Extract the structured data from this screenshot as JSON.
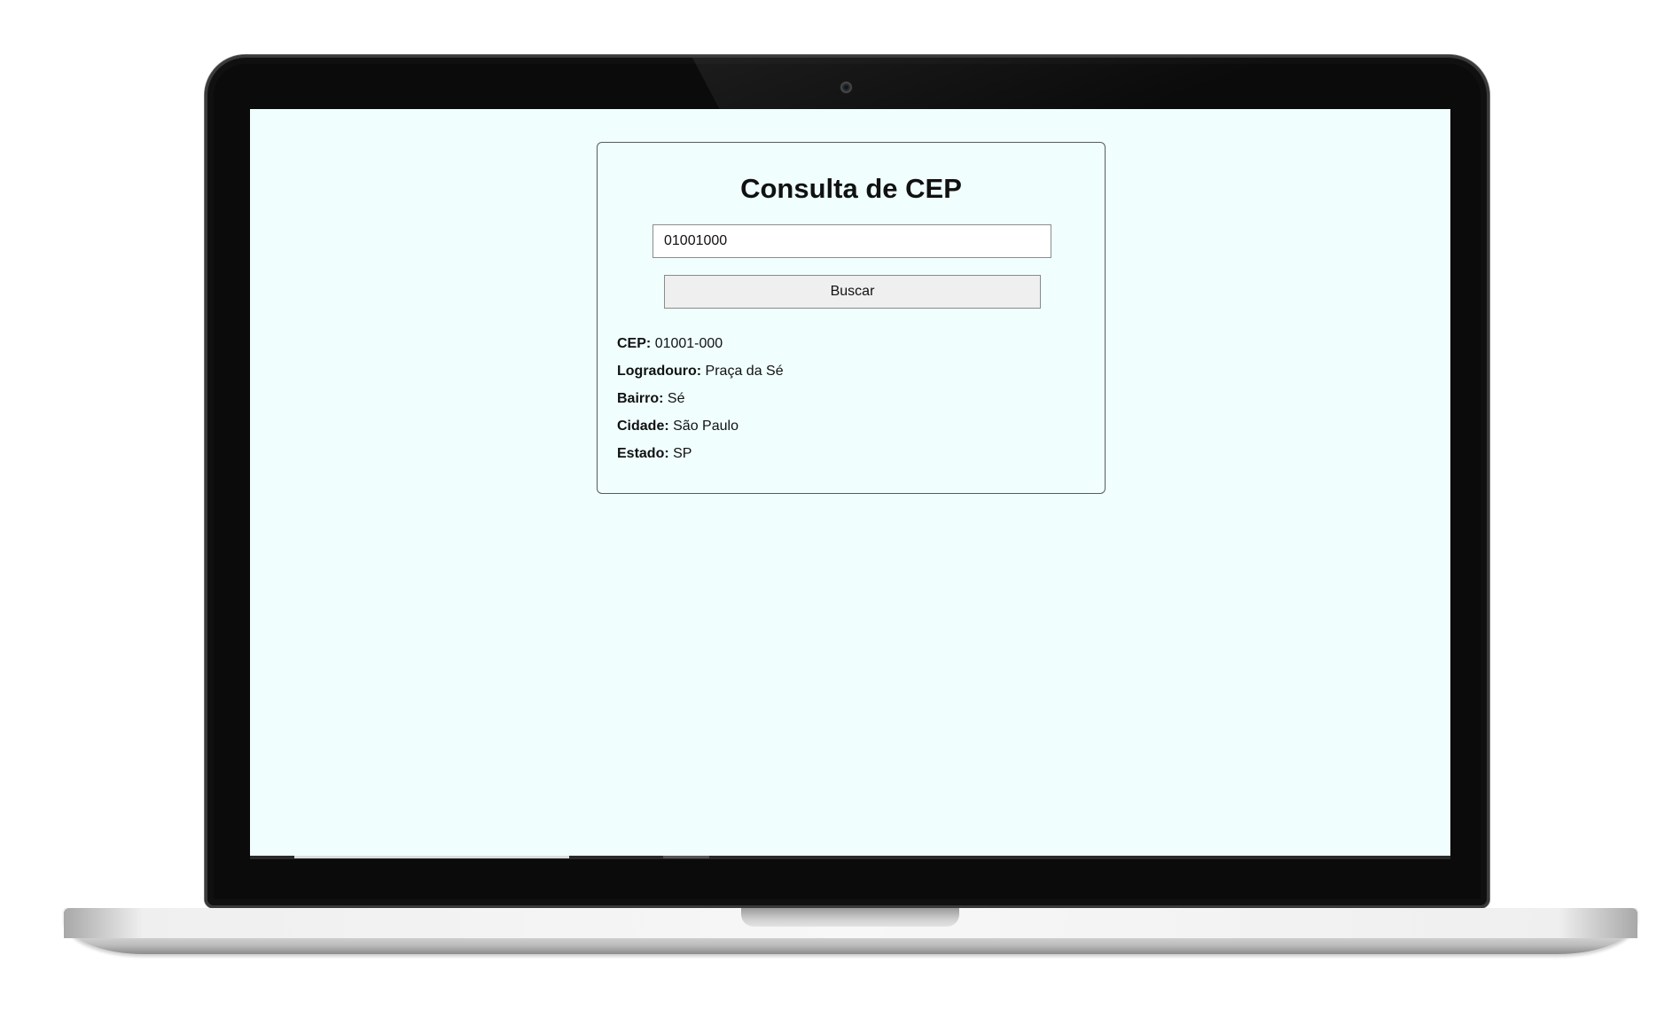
{
  "page": {
    "title": "Consulta de CEP"
  },
  "search": {
    "input_value": "01001000",
    "button_label": "Buscar"
  },
  "result": {
    "fields": [
      {
        "label": "CEP:",
        "value": "01001-000"
      },
      {
        "label": "Logradouro:",
        "value": "Praça da Sé"
      },
      {
        "label": "Bairro:",
        "value": "Sé"
      },
      {
        "label": "Cidade:",
        "value": "São Paulo"
      },
      {
        "label": "Estado:",
        "value": "SP"
      }
    ]
  },
  "colors": {
    "screen_background": "#f0fffe",
    "card_border": "#555b5f",
    "button_background": "#efefef"
  }
}
